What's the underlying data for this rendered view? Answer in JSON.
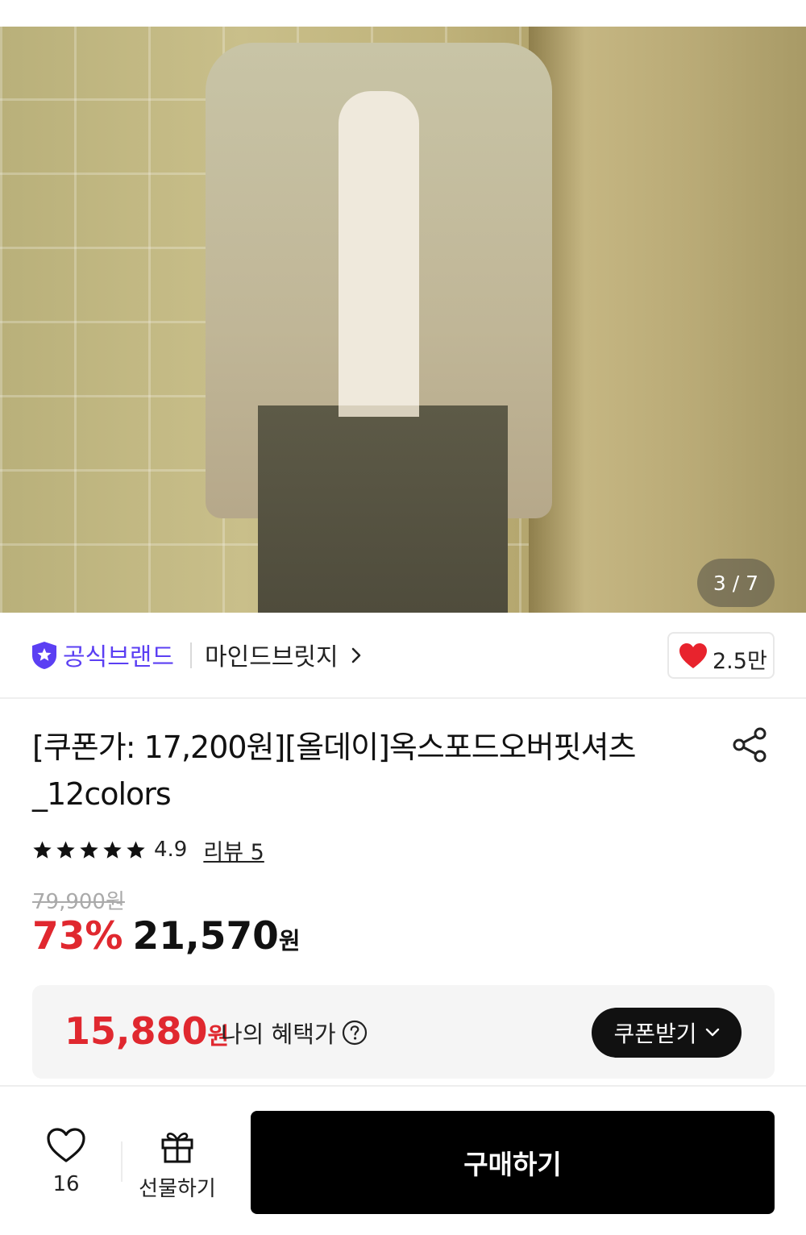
{
  "gallery": {
    "counter": "3 / 7"
  },
  "brand": {
    "official_label": "공식브랜드",
    "name": "마인드브릿지",
    "like_count": "2.5만"
  },
  "product": {
    "title": "[쿠폰가: 17,200원][올데이]옥스포드오버핏셔츠_12colors",
    "rating": "4.9",
    "review_link": "리뷰 5",
    "star_count": 5,
    "original_price": "79,900원",
    "discount_rate": "73%",
    "sale_price": "21,570",
    "price_unit": "원"
  },
  "benefit": {
    "amount": "15,880",
    "unit": "원",
    "label": "나의 혜택가",
    "coupon_button": "쿠폰받기"
  },
  "bottom_bar": {
    "wish_count": "16",
    "gift_label": "선물하기",
    "buy_label": "구매하기"
  },
  "colors": {
    "brand_purple": "#5b3ff3",
    "discount_red": "#e0282f",
    "heart_red": "#e8232d"
  }
}
